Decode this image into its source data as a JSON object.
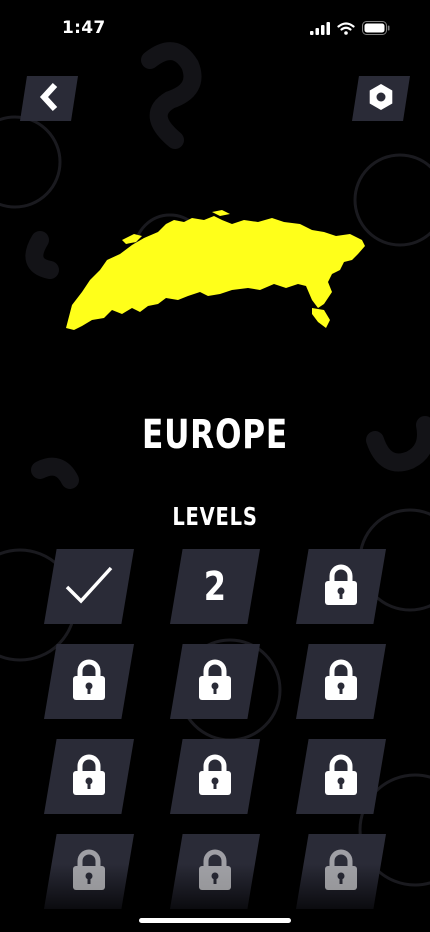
{
  "status_bar": {
    "time": "1:47",
    "battery_percent": 100
  },
  "header": {
    "back_icon": "chevron-left-icon",
    "settings_icon": "hexagon-icon"
  },
  "region": {
    "name": "EUROPE",
    "map_color": "#ffff1a"
  },
  "levels": {
    "title": "LEVELS",
    "items": [
      {
        "state": "completed",
        "icon": "checkmark-icon"
      },
      {
        "state": "current",
        "number": "2"
      },
      {
        "state": "locked",
        "icon": "lock-icon"
      },
      {
        "state": "locked",
        "icon": "lock-icon"
      },
      {
        "state": "locked",
        "icon": "lock-icon"
      },
      {
        "state": "locked",
        "icon": "lock-icon"
      },
      {
        "state": "locked",
        "icon": "lock-icon"
      },
      {
        "state": "locked",
        "icon": "lock-icon"
      },
      {
        "state": "locked",
        "icon": "lock-icon"
      },
      {
        "state": "locked",
        "icon": "lock-icon"
      },
      {
        "state": "locked",
        "icon": "lock-icon"
      },
      {
        "state": "locked",
        "icon": "lock-icon"
      }
    ]
  },
  "colors": {
    "background": "#000000",
    "tile": "#2a2b37",
    "accent": "#ffff1a"
  }
}
